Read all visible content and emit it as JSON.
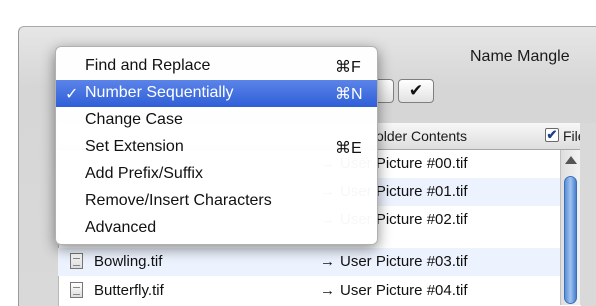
{
  "window": {
    "title": "Name Mangle"
  },
  "toolbar": {
    "apply_icon": "checkmark-icon",
    "apply_label": "✔"
  },
  "list_header": {
    "folder_contents": "older Contents",
    "files_checked": "✔",
    "files_label": "Files"
  },
  "files": [
    {
      "name": "Bowling.tif",
      "arrow": "→",
      "new_name": "User Picture #03.tif"
    },
    {
      "name": "Butterfly.tif",
      "arrow": "→",
      "new_name": "User Picture #04.tif"
    }
  ],
  "hidden_rows": [
    {
      "arrow": "→",
      "new_name": "User Picture #00.tif"
    },
    {
      "arrow": "→",
      "new_name": "User Picture #01.tif"
    },
    {
      "arrow": "→",
      "new_name": "User Picture #02.tif"
    }
  ],
  "menu": {
    "items": [
      {
        "check": "",
        "label": "Find and Replace",
        "shortcut": "⌘F"
      },
      {
        "check": "✓",
        "label": "Number Sequentially",
        "shortcut": "⌘N"
      },
      {
        "check": "",
        "label": "Change Case",
        "shortcut": ""
      },
      {
        "check": "",
        "label": "Set Extension",
        "shortcut": "⌘E"
      },
      {
        "check": "",
        "label": "Add Prefix/Suffix",
        "shortcut": ""
      },
      {
        "check": "",
        "label": "Remove/Insert Characters",
        "shortcut": ""
      },
      {
        "check": "",
        "label": "Advanced",
        "shortcut": ""
      }
    ]
  },
  "colors": {
    "selection": "#3a6ae0",
    "alt_row": "#edf3fe",
    "scroll_thumb": "#6c9de0"
  }
}
